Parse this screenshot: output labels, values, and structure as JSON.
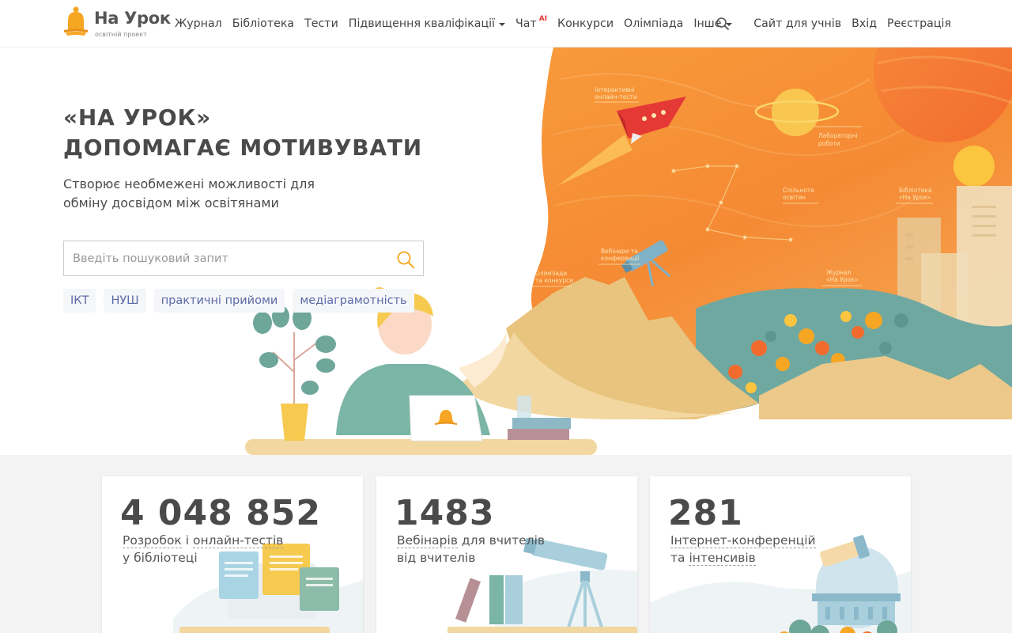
{
  "brand": {
    "title": "На Урок",
    "subtitle": "освітній проект",
    "bell_color": "#f6a623"
  },
  "nav": {
    "items": [
      {
        "label": "Журнал",
        "dropdown": false
      },
      {
        "label": "Бібліотека",
        "dropdown": false
      },
      {
        "label": "Тести",
        "dropdown": false
      },
      {
        "label": "Підвищення кваліфікації",
        "dropdown": true
      },
      {
        "label": "Чат",
        "badge": "AI",
        "dropdown": false
      },
      {
        "label": "Конкурси",
        "dropdown": false
      },
      {
        "label": "Олімпіада",
        "dropdown": false
      },
      {
        "label": "Інше",
        "dropdown": true
      }
    ],
    "search_icon": "search-icon",
    "right": {
      "students": "Сайт для учнів",
      "login": "Вхід",
      "register": "Реєстрація"
    }
  },
  "hero": {
    "title_line1": "«НА УРОК»",
    "title_line2": "ДОПОМАГАЄ МОТИВУВАТИ",
    "desc_line1": "Створює необмежені можливості для",
    "desc_line2": "обміну досвідом між освітянами",
    "search_placeholder": "Введіть пошуковий запит",
    "tags": [
      "ІКТ",
      "НУШ",
      "практичні прийоми",
      "медіаграмотність"
    ],
    "illustration_labels": {
      "tests": "Інтерактивні онлайн-тести",
      "labs": "Лабораторні роботи",
      "community": "Спільнота освітян",
      "library": "Бібліотека «На Урок»",
      "webinars": "Вебінари та конференції",
      "olympiads": "Олімпіади та конкурси",
      "journal": "Журнал «На Урок»"
    },
    "accent_orange": "#f7892e",
    "accent_yellow": "#f8c34a"
  },
  "stats": [
    {
      "value": "4 048 852",
      "line1_a": "Розробок",
      "line1_b": "і",
      "line1_c": "онлайн-тестів",
      "line2": "у бібліотеці"
    },
    {
      "value": "1483",
      "line1_a": "Вебінарів",
      "line1_b": "для вчителів",
      "line2": "від вчителів"
    },
    {
      "value": "281",
      "line1_a": "Інтернет-конференцій",
      "line2_a": "та",
      "line2_b": "інтенсивів"
    }
  ]
}
